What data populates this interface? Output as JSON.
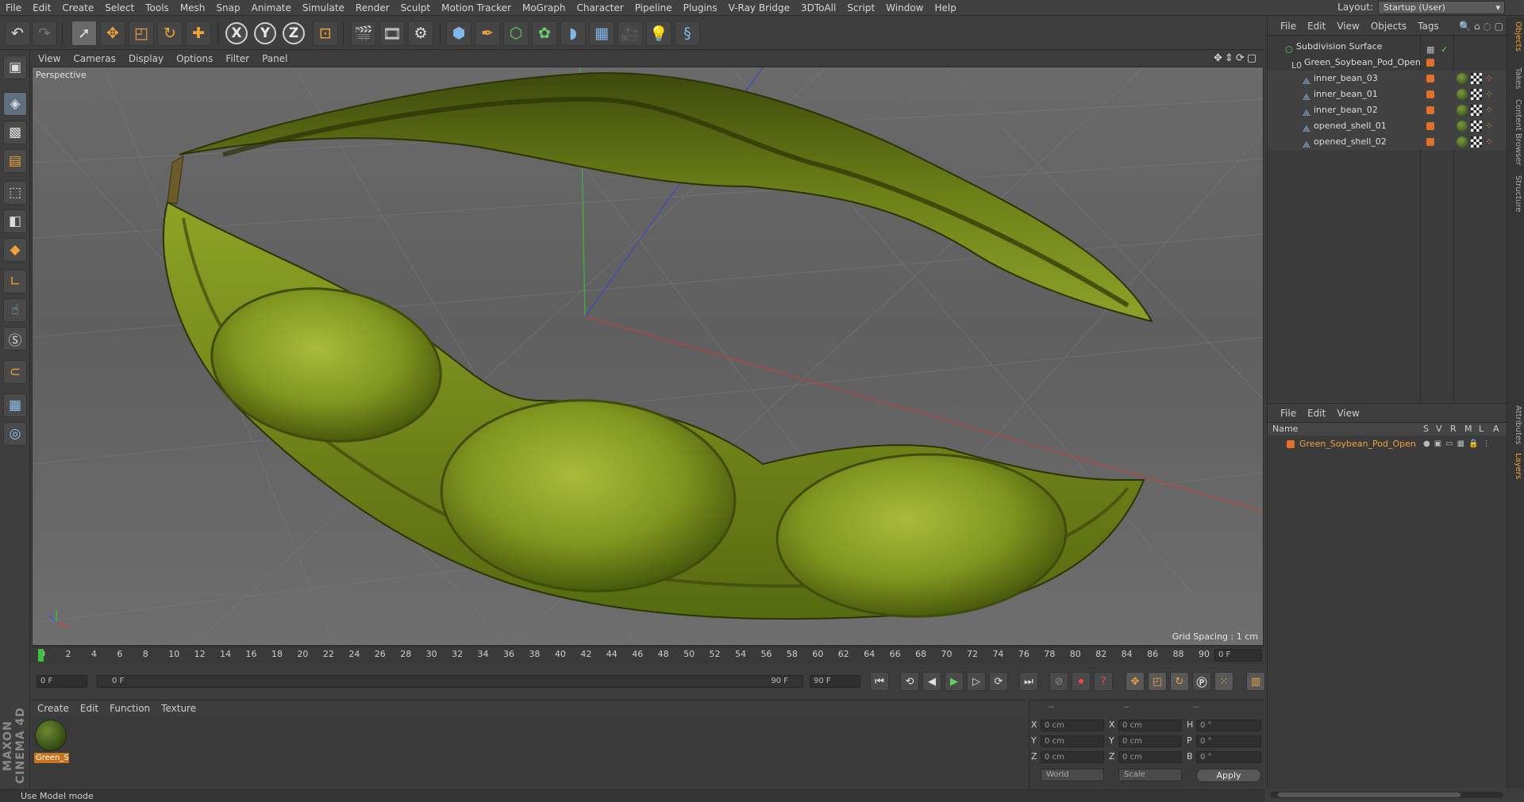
{
  "menubar": {
    "items": [
      "File",
      "Edit",
      "Create",
      "Select",
      "Tools",
      "Mesh",
      "Snap",
      "Animate",
      "Simulate",
      "Render",
      "Sculpt",
      "Motion Tracker",
      "MoGraph",
      "Character",
      "Pipeline",
      "Plugins",
      "V-Ray Bridge",
      "3DToAll",
      "Script",
      "Window",
      "Help"
    ],
    "layout_label": "Layout:",
    "layout_value": "Startup (User)"
  },
  "toolbar": {
    "x_label": "X",
    "y_label": "Y",
    "z_label": "Z"
  },
  "viewport": {
    "menu": [
      "View",
      "Cameras",
      "Display",
      "Options",
      "Filter",
      "Panel"
    ],
    "label": "Perspective",
    "grid_spacing": "Grid Spacing : 1 cm"
  },
  "timeline": {
    "ticks": [
      "0",
      "2",
      "4",
      "6",
      "8",
      "10",
      "12",
      "14",
      "16",
      "18",
      "20",
      "22",
      "24",
      "26",
      "28",
      "30",
      "32",
      "34",
      "36",
      "38",
      "40",
      "42",
      "44",
      "46",
      "48",
      "50",
      "52",
      "54",
      "56",
      "58",
      "60",
      "62",
      "64",
      "66",
      "68",
      "70",
      "72",
      "74",
      "76",
      "78",
      "80",
      "82",
      "84",
      "86",
      "88",
      "90"
    ],
    "current_frame": "0 F",
    "start_frame": "0 F",
    "range_start": "0 F",
    "range_end": "90 F",
    "end_frame": "90 F"
  },
  "material_panel": {
    "menu": [
      "Create",
      "Edit",
      "Function",
      "Texture"
    ],
    "material_name": "Green_S"
  },
  "coordinates": {
    "headers": [
      "--",
      "--",
      "--"
    ],
    "pos_label": [
      "X",
      "Y",
      "Z"
    ],
    "pos_value": [
      "0 cm",
      "0 cm",
      "0 cm"
    ],
    "size_label": [
      "X",
      "Y",
      "Z"
    ],
    "size_value": [
      "0 cm",
      "0 cm",
      "0 cm"
    ],
    "rot_label": [
      "H",
      "P",
      "B"
    ],
    "rot_value": [
      "0 °",
      "0 °",
      "0 °"
    ],
    "world_select": "World",
    "scale_select": "Scale",
    "apply_label": "Apply"
  },
  "status": {
    "text": "Use Model mode"
  },
  "objects_panel": {
    "menu": [
      "File",
      "Edit",
      "View",
      "Objects",
      "Tags"
    ],
    "rows": [
      {
        "name": "Subdivision Surface"
      },
      {
        "name": "Green_Soybean_Pod_Open"
      },
      {
        "name": "inner_bean_03"
      },
      {
        "name": "inner_bean_01"
      },
      {
        "name": "inner_bean_02"
      },
      {
        "name": "opened_shell_01"
      },
      {
        "name": "opened_shell_02"
      }
    ]
  },
  "layers_panel": {
    "menu": [
      "File",
      "Edit",
      "View"
    ],
    "columns": [
      "Name",
      "S",
      "V",
      "R",
      "M",
      "L",
      "A"
    ],
    "layer_name": "Green_Soybean_Pod_Open"
  },
  "side_tabs": [
    "Objects",
    "Takes",
    "Content Browser",
    "Structure",
    "Attributes",
    "Layers"
  ],
  "colors": {
    "accent": "#f0a23a",
    "pod_green": "#8aa226",
    "viewport_bg": "#656565"
  }
}
